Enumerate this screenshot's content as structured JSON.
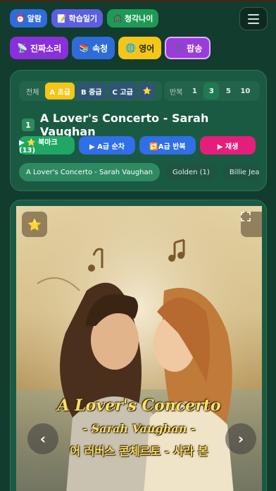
{
  "top_menu": [
    {
      "icon": "alarm-clock-icon",
      "emoji": "⏰",
      "label": "알람"
    },
    {
      "icon": "notebook-icon",
      "emoji": "📝",
      "label": "학습일기"
    },
    {
      "icon": "headphones-icon",
      "emoji": "🎧",
      "label": "청각나이"
    }
  ],
  "categories": [
    {
      "icon": "satellite-icon",
      "emoji": "📡",
      "label": "진짜소리"
    },
    {
      "icon": "books-icon",
      "emoji": "📚",
      "label": "속청"
    },
    {
      "icon": "globe-icon",
      "emoji": "🌐",
      "label": "영어"
    },
    {
      "icon": "music-note-icon",
      "emoji": "🎵",
      "label": "팝송"
    }
  ],
  "levels": {
    "all": "전체",
    "a": "A 초급",
    "b": "B 중급",
    "c": "C 고급",
    "star": "⭐"
  },
  "repeat": {
    "label": "반복",
    "options": [
      "1",
      "3",
      "5",
      "10"
    ],
    "selected": "3"
  },
  "song": {
    "number": "1",
    "title": "A Lover's Concerto - Sarah Vaughan"
  },
  "actions": {
    "bookmark": "▶ ⭐ 북마크 (13)",
    "a_order": "▶ A급 순차",
    "a_repeat": "🔁A급 반복",
    "play": "▶ 재생"
  },
  "playlist": [
    "A Lover's Concerto - Sarah Vaughan",
    "Golden (1)",
    "Billie Jean"
  ],
  "artwork": {
    "line1": "A Lover's Concerto",
    "line2": "- Sarah Vaughan -",
    "line3": "어 러버스 콘체르토 - 사라 본"
  },
  "colors": {
    "background": "#123c2e",
    "panel": "#1a5a42",
    "accent_yellow": "#f5c518",
    "accent_pink": "#e51e7b"
  }
}
